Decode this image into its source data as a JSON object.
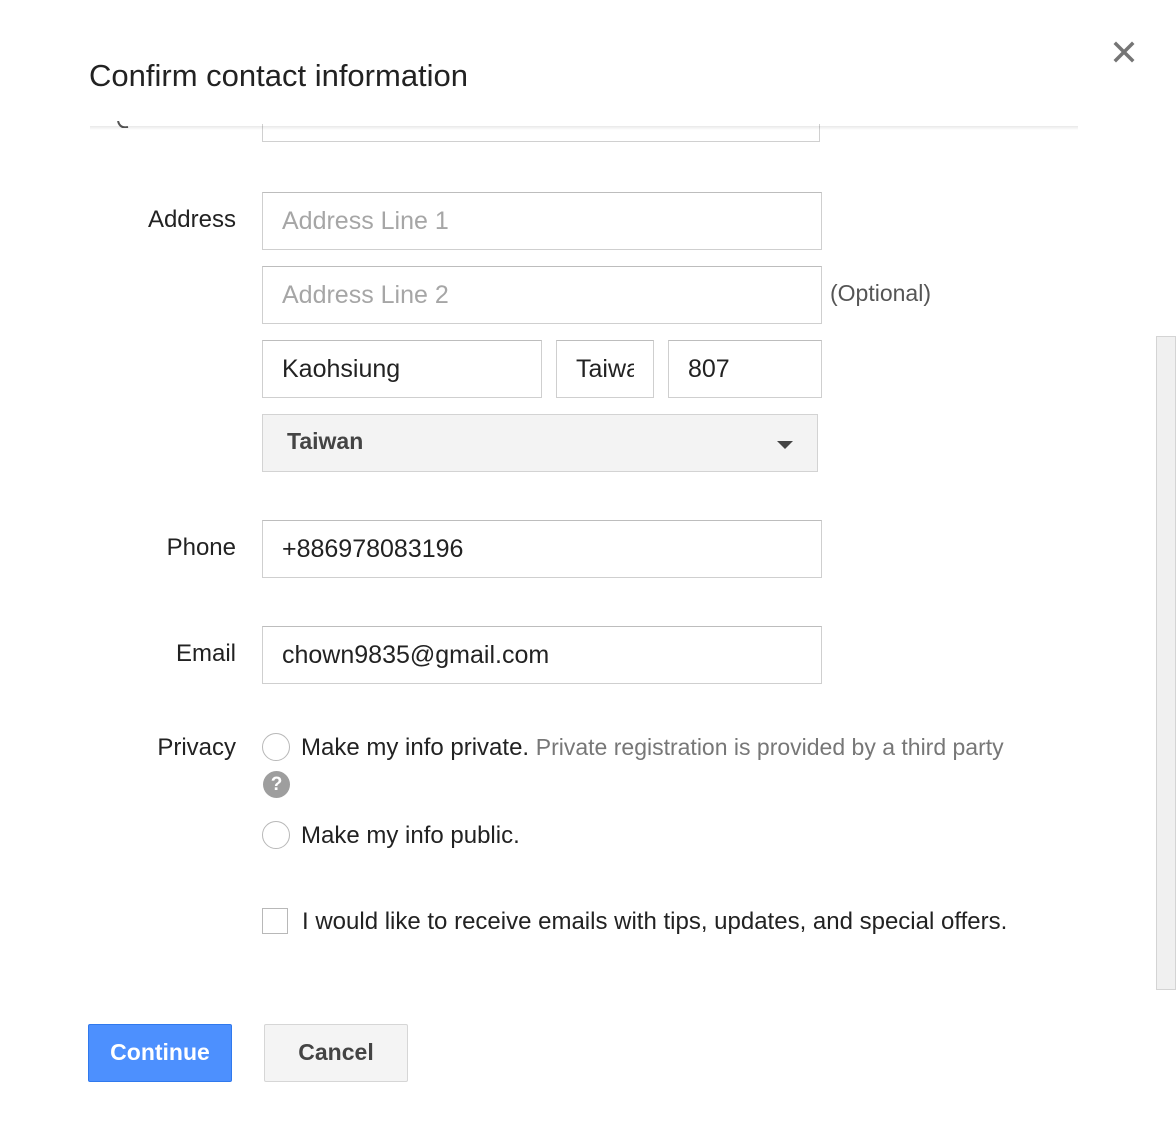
{
  "dialog": {
    "title": "Confirm contact information"
  },
  "labels": {
    "address": "Address",
    "phone": "Phone",
    "email": "Email",
    "privacy": "Privacy"
  },
  "address": {
    "line1_placeholder": "Address Line 1",
    "line2_placeholder": "Address Line 2",
    "optional": "(Optional)",
    "city": "Kaohsiung",
    "state": "Taiwan",
    "postal": "807",
    "country": "Taiwan"
  },
  "phone": {
    "value": "+886978083196"
  },
  "email": {
    "value": "chown9835@gmail.com"
  },
  "privacy": {
    "private_label": "Make my info private.",
    "private_note": "Private registration is provided by a third party",
    "help_symbol": "?",
    "public_label": "Make my info public."
  },
  "newsletter": {
    "label": "I would like to receive emails with tips, updates, and special offers."
  },
  "buttons": {
    "continue": "Continue",
    "cancel": "Cancel"
  },
  "colors": {
    "primary": "#4d90fe",
    "primary_border": "#3079ed",
    "help_icon": "#9e9e9e"
  }
}
